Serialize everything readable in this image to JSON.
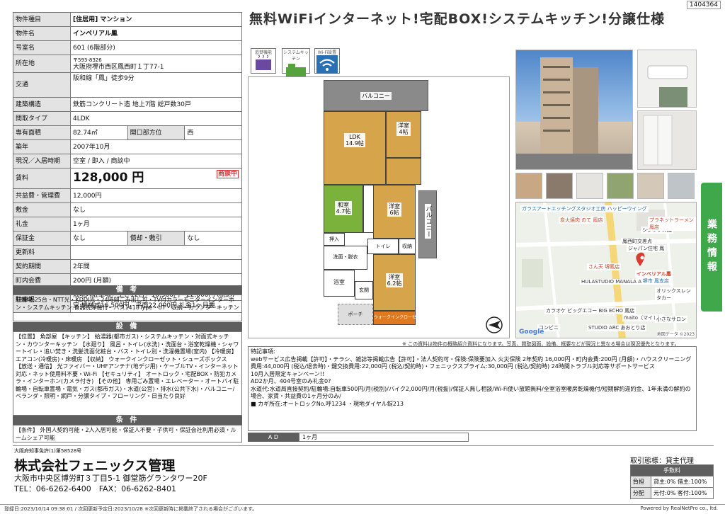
{
  "doc_id": "1404364",
  "headline": "無料WiFiインターネット!宅配BOX!システムキッチン!分譲仕様",
  "table": {
    "rows": [
      {
        "label": "物件種目",
        "value": "[住居用] マンション"
      },
      {
        "label": "物件名",
        "value": "インペリアル鳳"
      },
      {
        "label": "号室名",
        "value": "601 (6階部分)"
      },
      {
        "label": "所在地",
        "value": "〒593-8326",
        "value2": "大阪府堺市西区鳳西町１丁77-1"
      },
      {
        "label": "交通",
        "value": "阪和線「鳳」徒歩9分"
      },
      {
        "label": "建築構造",
        "value": "鉄筋コンクリート造 地上7階 総戸数30戸"
      },
      {
        "label": "間取タイプ",
        "value": "4LDK"
      },
      {
        "label": "専有面積",
        "value": "82.74㎡",
        "label2": "開口部方位",
        "value2": "西"
      },
      {
        "label": "築年",
        "value": "2007年10月"
      },
      {
        "label": "現況／入居時期",
        "value": "空室 / 即入 / 商談中"
      },
      {
        "label": "賃料",
        "value": "128,000 円",
        "stamp": "商談中"
      },
      {
        "label": "共益費・管理費",
        "value": "12,000円"
      },
      {
        "label": "敷金",
        "value": "なし"
      },
      {
        "label": "礼金",
        "value": "1ヶ月"
      },
      {
        "label": "保証金",
        "value": "なし",
        "label2": "償却・敷引",
        "value2": "なし"
      },
      {
        "label": "更新料",
        "value": ""
      },
      {
        "label": "契約期間",
        "value": "2年間"
      },
      {
        "label": "町内会費",
        "value": "200円 (月額)"
      },
      {
        "label": "駐車場",
        "value": "敷地内駐車場／空き12台／16,500円～22,000円 (税込)",
        "value2": "空:機械式16,500円、平面22,000円 礼金1ヶ月要"
      }
    ],
    "bikou_header": "備 考",
    "bikou_text": "駐輪場:25台・NTT光・KDDI光・24時間ごみ出し可・TV付カラーモニターインターホン・システムキッチン:食器洗浄機付・バス1418Type・UT・収納・カウンターキッチン",
    "setsubi_header": "設 備",
    "setsubi_text": "【位置】 角部屋 【キッチン】 給湯器(都市ガス)・システムキッチン・対面式キッチン・カウンターキッチン 【水廻り】 風呂・トイレ(水洗)・洗面台・浴室乾燥機・シャワートイレ・追い焚き・洗髪洗面化粧台・バス・トイレ別・洗濯機置場(室内) 【冷暖房】 エアコン(冷暖房)・床暖房 【収納】 ウォークインクローゼット・シューズボックス 【放送・通信】 光ファイバー・UHFアンテナ(地デジ用)・ケーブルTV・インターネット対応・ネット使用料不要・Wi-Fi 【セキュリティ】 オートロック・宅配BOX・防犯カメラ・インターホン(カメラ付き) 【その他】 専用ごみ置場・エレベーター・オートバイ駐輪場・自転車置場・電気・ガス(都市ガス)・水道(公営)・排水(公共下水)・バルコニー/ベランダ・照明・網戸・分譲タイプ・フローリング・日当たり良好",
    "jouken_header": "条 件",
    "jouken_text": "【条件】 外国人契約可能・2人入居可能・保証人不要・子供可・保証会社利用必須・ルームシェア可能"
  },
  "badges": [
    {
      "label": "追焚機能",
      "icon": "reheat-icon"
    },
    {
      "label": "システムキッチン",
      "icon": "kitchen-icon"
    },
    {
      "label": "Wi-Fi設置",
      "icon": "wifi-icon"
    }
  ],
  "floorplan": {
    "rooms": {
      "balcony_top": "バルコニー",
      "balcony_right": "バルコニー",
      "ldk": "LDK\n14.9帖",
      "yoshitsu1": "洋室\n4帖",
      "washitsu": "和室\n4.7帖",
      "yoshitsu2": "洋室\n6帖",
      "yoshitsu3": "洋室\n6.2帖",
      "oshiire": "押入",
      "toilet": "トイレ",
      "storage": "収納",
      "wash": "洗面・脱衣",
      "bath": "浴室",
      "entrance": "玄関",
      "porch": "ポーチ",
      "wic": "ウォークインクローゼット"
    }
  },
  "disclaimer": "※ この資料は物件の概略紹介資料になります。写真、間取図面、設備、概要などが現況と異なる場合は現況優先となります。",
  "map": {
    "labels": [
      "ガラスアートエッチングスタジオ工房 ハッピーウイング",
      "炭火焼肉 のて 鳳店",
      "シダックス鳳",
      "プラネットラーメン 鳳店",
      "さん天 堺鳳店",
      "インペリアル鳳",
      "JA堺市 鳳支店",
      "ジャパン住宅 鳳",
      "HULASTUDIO MANALA A",
      "オリックスレンタカー",
      "カラオケ ビッグエコー BIG ECHO 鳳店",
      "maito（マイト）",
      "STUDIO ARC あおとり店",
      "小さなサロン",
      "コンビニ",
      "鳳西町交差点"
    ],
    "google": "Google",
    "copyright": "地図データ ©2023"
  },
  "side_tab": "業務情報",
  "notes": {
    "title": "特記事項:",
    "lines": [
      "webサービス広告掲載【許可】・チラシ、雑誌等掲載広告【許可】・法人契約可・保険:保険要加入 火災保険 2年契約 16,000円・町内会費:200円 (月額)・ハウスクリーニング費用:44,000円 (税込/退去時)・鍵交換費用:22,000円 (税込/契約時)・フェニックスプライム:30,000円 (税込/契約時) 24時間トラブル対応等サポートサービス",
      "10月入居限定キャンペーン!!",
      "AD2か月、404号室のみ礼金0?",
      "水道代:水道局直接契約/駐輪場:自転車500円/月(税別)/バイク2,000円/月(税抜)/保証人無し相談/Wi-Fi使い放題無料/全室浴室暖房乾燥機付/短期解約違約金、1年未満の解約の場合、家賃・共益費の1ヶ月分のみ/",
      "■ カギ所在:オートロックNo.呼1234 ・現地ダイヤル錠213"
    ]
  },
  "ad": {
    "label": "A D",
    "value": "1ヶ月"
  },
  "company": {
    "license": "大阪府知事免許(1)第58528号",
    "name": "株式会社フェニックス管理",
    "address": "大阪市中央区博労町３丁目5-1 御堂筋グランタワー20F",
    "tel": "TEL：06-6262-6400　FAX：06-6262-8401"
  },
  "fees": {
    "mode": "取引態様：貸主代理",
    "header": "手数料",
    "rows": [
      {
        "label": "負担",
        "value": "貸主:0% 借主:100%"
      },
      {
        "label": "分配",
        "value": "元付:0% 客付:100%"
      }
    ]
  },
  "footer": {
    "left": "登録日:2023/10/14 09:38:01 / 次回更新予定日:2023/10/28 ※次回更新時に掲載終了される場合がございます。",
    "right": "Powered by RealNetPro co., ltd."
  },
  "colors": {
    "wood": "#d6a44a",
    "washitsu": "#7ab23c",
    "wic": "#e07a20",
    "side_tab": "#3fa84b",
    "header_gray": "#5e5e5e",
    "map_pin": "#d93b30"
  }
}
